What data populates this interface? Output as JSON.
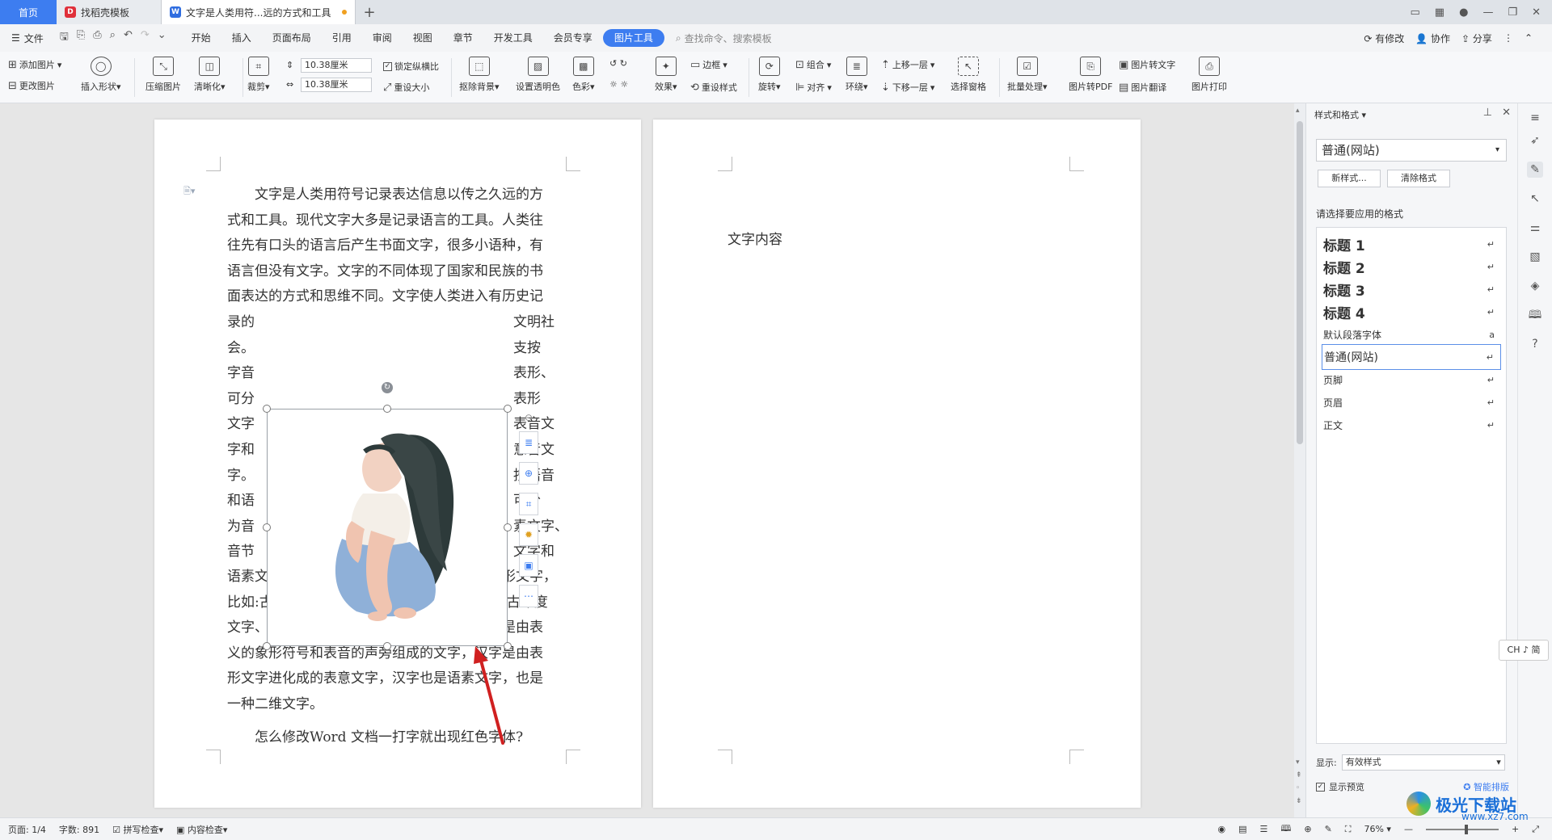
{
  "tabs": {
    "home": "首页",
    "template": "找稻壳模板",
    "document": "文字是人类用符...远的方式和工具",
    "add": "+"
  },
  "menu": {
    "file": "文件",
    "items": [
      "开始",
      "插入",
      "页面布局",
      "引用",
      "审阅",
      "视图",
      "章节",
      "开发工具",
      "会员专享",
      "图片工具"
    ],
    "search": "查找命令、搜索模板",
    "modified": "有修改",
    "collab": "协作",
    "share": "分享"
  },
  "ribbon": {
    "add_picture": "添加图片",
    "change_picture": "更改图片",
    "insert_shape": "插入形状",
    "compress": "压缩图片",
    "sharpen": "清晰化",
    "crop": "裁剪",
    "width_value": "10.38厘米",
    "height_value": "10.38厘米",
    "lock_ratio": "锁定纵横比",
    "reset_size": "重设大小",
    "remove_bg": "抠除背景",
    "set_transparent": "设置透明色",
    "color": "色彩",
    "effects": "效果",
    "border": "边框",
    "reset_style": "重设样式",
    "rotate": "旋转",
    "group": "组合",
    "align": "对齐",
    "wrap": "环绕",
    "bring_forward": "上移一层",
    "send_backward": "下移一层",
    "selection_pane": "选择窗格",
    "batch": "批量处理",
    "to_pdf": "图片转PDF",
    "to_text": "图片转文字",
    "translate": "图片翻译",
    "print": "图片打印"
  },
  "document": {
    "page1_top_lines": [
      "文字是人类用符号记录表达信息以传之久远的方",
      "式和工具。现代文字大多是记录语言的工具。人类往",
      "往先有口头的语言后产生书面文字，很多小语种，有",
      "语言但没有文字。文字的不同体现了国家和民族的书",
      "面表达的方式和思维不同。文字使人类进入有历史记"
    ],
    "left_col": [
      "录的",
      "会。",
      "字音",
      "可分",
      "文字",
      "字和",
      "字。",
      "和语",
      "为音",
      "音节"
    ],
    "right_col": [
      "文明社",
      "支按",
      "表形、",
      "表形",
      "表音文",
      "意音文",
      "按语音",
      "可分",
      "素文字、",
      "文字和"
    ],
    "page1_bottom_lines": [
      "语素文字。表形文字是人类早期原生文字的象形文字，",
      "比如:古埃及的圣书字、两河流域的楔形文字、古印度",
      "文字、美洲的玛雅文和早期的汉字。意音文字是由表",
      "义的象形符号和表音的声旁组成的文字，汉字是由表",
      "形文字进化成的表意文字，汉字也是语素文字，也是",
      "一种二维文字。"
    ],
    "question": "怎么修改Word 文档一打字就出现红色字体?",
    "page2_text": "文字内容"
  },
  "styles_panel": {
    "title": "样式和格式",
    "current_style": "普通(网站)",
    "new_style": "新样式...",
    "clear_format": "清除格式",
    "apply_label": "请选择要应用的格式",
    "items": [
      {
        "label": "标题  1",
        "mark": "↵"
      },
      {
        "label": "标题  2",
        "mark": "↵"
      },
      {
        "label": "标题  3",
        "mark": "↵"
      },
      {
        "label": "标题  4",
        "mark": "↵"
      },
      {
        "label": "默认段落字体",
        "mark": "a"
      },
      {
        "label": "普通(网站)",
        "mark": "↵"
      },
      {
        "label": "页脚",
        "mark": "↵"
      },
      {
        "label": "页眉",
        "mark": "↵"
      },
      {
        "label": "正文",
        "mark": "↵"
      }
    ],
    "show_label": "显示:",
    "show_value": "有效样式",
    "preview_label": "显示预览",
    "smart_layout": "智能排版"
  },
  "ime": "CH ♪ 简",
  "status": {
    "page": "页面: 1/4",
    "words": "字数: 891",
    "spell": "拼写检查",
    "content_check": "内容检查",
    "zoom": "76%"
  },
  "watermark": {
    "brand": "极光下载站",
    "url": "www.xz7.com"
  },
  "colors": {
    "accent": "#3d7df0",
    "arrow": "#d02020"
  }
}
